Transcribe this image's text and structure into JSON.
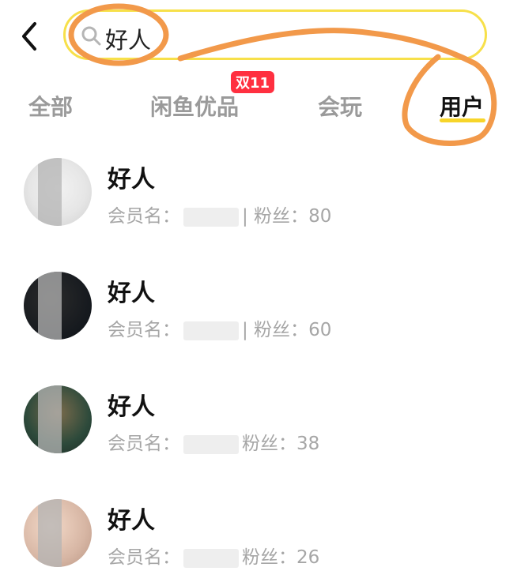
{
  "search": {
    "query": "好人"
  },
  "tabs": [
    {
      "label": "全部"
    },
    {
      "label": "闲鱼优品"
    },
    {
      "label": "会玩"
    },
    {
      "label": "用户"
    }
  ],
  "promo_badge": "双11",
  "users": [
    {
      "name": "好人",
      "member_label": "会员名：",
      "fans_label": "| 粉丝：",
      "fans_count": "80"
    },
    {
      "name": "好人",
      "member_label": "会员名：",
      "fans_label": "| 粉丝：",
      "fans_count": "60"
    },
    {
      "name": "好人",
      "member_label": "会员名：",
      "fans_label": "粉丝：",
      "fans_count": "38"
    },
    {
      "name": "好人",
      "member_label": "会员名：",
      "fans_label": "粉丝：",
      "fans_count": "26"
    }
  ],
  "colors": {
    "accent": "#f7e04a",
    "annotation": "#f2994a",
    "badge": "#ff3040"
  },
  "icons": {
    "back": "chevron-left-icon",
    "search": "search-icon"
  }
}
